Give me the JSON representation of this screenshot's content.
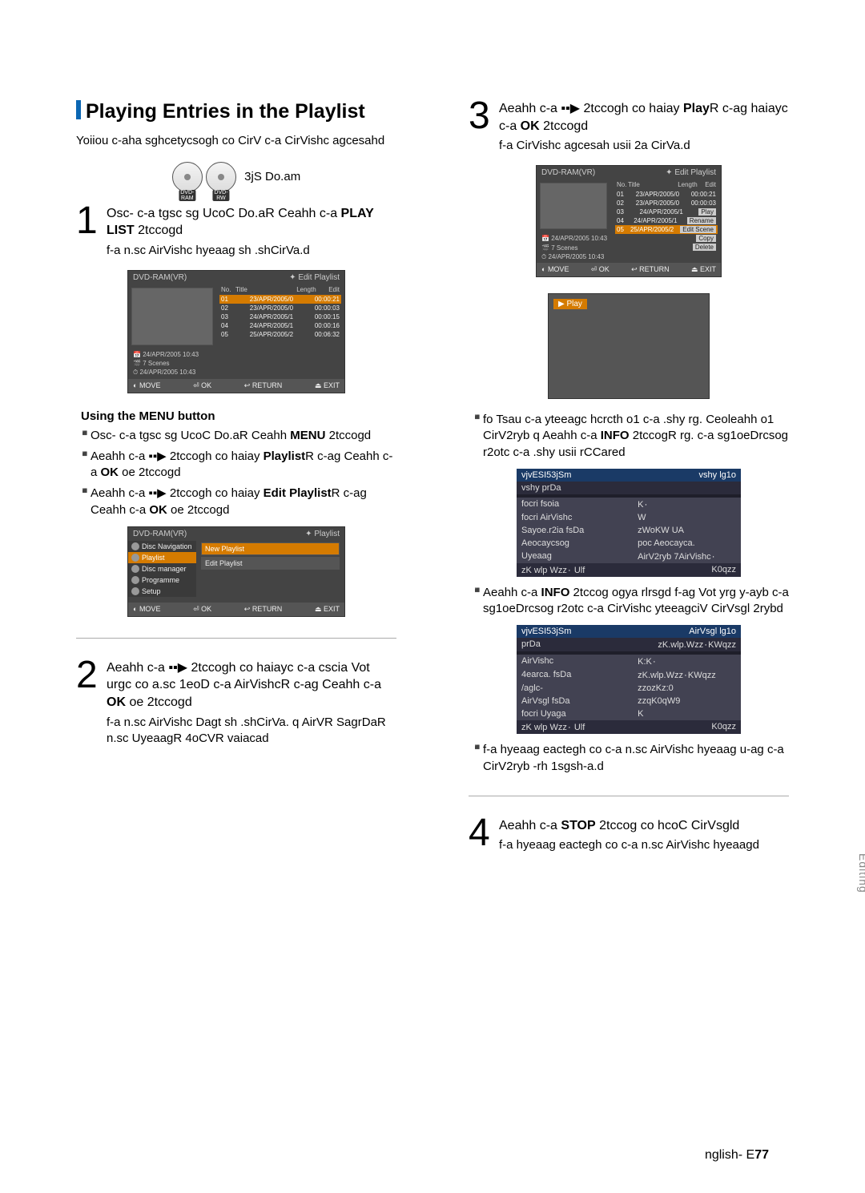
{
  "sectionTitle": "Playing Entries in the Playlist",
  "sectionDesc": "Yoiiou c-aha sghcetycsogh co CirV c-a CirVishc agcesahd",
  "mediaNote": "3jS Do.am",
  "mediaLabels": {
    "ram": "DVD-RAM",
    "rw": "DVD-RW"
  },
  "step1": {
    "text_a": "Osc- c-a tgsc sg UcoC Do.aR Ceahh c-a ",
    "text_b": "PLAY LIST",
    "text_c": " 2tccogd",
    "sub": "f-a n.sc AirVishc hyeaag sh .shCirVa.d"
  },
  "osd1": {
    "topLeft": "DVD-RAM(VR)",
    "topRight": "✦ Edit Playlist",
    "header": {
      "no": "No.",
      "title": "Title",
      "length": "Length",
      "edit": "Edit"
    },
    "rows": [
      {
        "n": "01",
        "t": "23/APR/2005/0",
        "l": "00:00:21",
        "sel": true
      },
      {
        "n": "02",
        "t": "23/APR/2005/0",
        "l": "00:00:03"
      },
      {
        "n": "03",
        "t": "24/APR/2005/1",
        "l": "00:00:15"
      },
      {
        "n": "04",
        "t": "24/APR/2005/1",
        "l": "00:00:16"
      },
      {
        "n": "05",
        "t": "25/APR/2005/2",
        "l": "00:06:32"
      }
    ],
    "info": [
      "24/APR/2005 10:43",
      "7 Scenes",
      "24/APR/2005 10:43"
    ],
    "bottom": {
      "move": "MOVE",
      "ok": "OK",
      "ret": "RETURN",
      "exit": "EXIT"
    }
  },
  "menuHead": "Using the MENU button",
  "menuBullets": [
    {
      "a": "Osc- c-a tgsc sg UcoC Do.aR Ceahh ",
      "b": "MENU",
      "c": " 2tccogd"
    },
    {
      "a": "Aeahh c-a ▪▪▶ 2tccogh co haiay ",
      "b": "Playlist",
      "c": "R c-ag Ceahh c-a ",
      "d": "OK",
      "e": " oe   2tccogd"
    },
    {
      "a": "Aeahh c-a ▪▪▶ 2tccogh co haiay ",
      "b": "Edit Playlist",
      "c": "R c-ag Ceahh c-a ",
      "d": "OK",
      "e": " oe   2tccogd"
    }
  ],
  "osdMenu": {
    "topLeft": "DVD-RAM(VR)",
    "topRight": "✦ Playlist",
    "side": [
      "Disc Navigation",
      "Playlist",
      "Disc manager",
      "Programme",
      "Setup"
    ],
    "panel": [
      "New Playlist",
      "Edit Playlist"
    ],
    "bottom": {
      "move": "MOVE",
      "ok": "OK",
      "ret": "RETURN",
      "exit": "EXIT"
    }
  },
  "step2": {
    "text_a": "Aeahh c-a ▪▪▶ 2tccogh co haiayc c-a cscia Vot urgc co a.sc 1eoD c-a AirVishcR c-ag Ceahh c-a ",
    "text_b": "OK",
    "text_c": " oe   2tccogd",
    "sub": "f-a n.sc AirVishc Dagt sh .shCirVa. q AirVR SagrDaR n.sc UyeaagR 4oCVR vaiacad"
  },
  "step3": {
    "text_a": "Aeahh c-a ▪▪▶ 2tccogh co haiay ",
    "text_b": "Play",
    "text_c": "R c-ag haiayc c-a ",
    "text_d": "OK",
    "text_e": " 2tccogd",
    "sub": "f-a CirVishc agcesah usii 2a CirVa.d"
  },
  "osd3": {
    "topLeft": "DVD-RAM(VR)",
    "topRight": "✦ Edit Playlist",
    "header": {
      "no": "No.",
      "title": "Title",
      "length": "Length",
      "edit": "Edit"
    },
    "rows": [
      {
        "n": "01",
        "t": "23/APR/2005/0",
        "l": "00:00:21"
      },
      {
        "n": "02",
        "t": "23/APR/2005/0",
        "l": "00:00:03"
      },
      {
        "n": "03",
        "t": "24/APR/2005/1",
        "ctx": "Play"
      },
      {
        "n": "04",
        "t": "24/APR/2005/1",
        "ctx": "Rename"
      },
      {
        "n": "05",
        "t": "25/APR/2005/2",
        "ctx": "Edit Scene",
        "sel": true
      }
    ],
    "ctxExtra": [
      "Copy",
      "Delete"
    ],
    "info": [
      "24/APR/2005 10:43",
      "7 Scenes",
      "24/APR/2005 10:43"
    ],
    "bottom": {
      "move": "MOVE",
      "ok": "OK",
      "ret": "RETURN",
      "exit": "EXIT"
    }
  },
  "playBadge": "▶ Play",
  "rightBullets": [
    {
      "a": "fo Tsau c-a yteeagc hcrcth o1 c-a .shy rg. Ceoleahh o1 CirV2ryb q Aeahh c-a ",
      "b": "INFO",
      "c": " 2tccogR rg. c-a sg1oeDrcsog r2otc c-a .shy usii rCCared"
    },
    {
      "a": "Aeahh c-a ",
      "b": "INFO",
      "c": " 2tccog ogya rlrsgd f-ag Vot yrg y-ayb c-a sg1oeDrcsog r2otc c-a CirVishc yteeagciV CirVsgl 2rybd"
    },
    {
      "a": "f-a hyeaag eactegh co c-a n.sc AirVishc hyeaag u-ag c-a CirV2ryb -rh 1sgsh-a.d"
    }
  ],
  "table1": {
    "hdrL": "vjvESI53jSm",
    "hdrR": "vshy lg1o",
    "rows": [
      {
        "l": "vshy prDa",
        "r": ""
      },
      {
        "l": "focri fsoia",
        "r": "K٠"
      },
      {
        "l": "focri AirVishc",
        "r": "W"
      },
      {
        "l": "Sayoe.r2ia fsDa",
        "r": "zWoKW  UA"
      },
      {
        "l": "Aeocaycsog",
        "r": "poc Aeocayca."
      },
      {
        "l": "Uyeaag",
        "r": "AirV2ryb 7AirVishc٠"
      },
      {
        "l": "zK wlp Wzz٠ Ulf",
        "r": "K0qzz"
      }
    ]
  },
  "table2": {
    "hdrL": "vjvESI53jSm",
    "hdrR": "AirVsgl lg1o",
    "rows": [
      {
        "l": "prDa",
        "r": "zK.wlp.Wzz٠KWqzz"
      },
      {
        "l": "AirVishc",
        "r": "K:K٠"
      },
      {
        "l": "4earca. fsDa",
        "r": "zK.wlp.Wzz٠KWqzz"
      },
      {
        "l": "/aglc-",
        "r": "zzozKz:0"
      },
      {
        "l": "AirVsgl fsDa",
        "r": "zzqK0qW9"
      },
      {
        "l": "focri Uyaga",
        "r": "K"
      },
      {
        "l": "zK wlp Wzz٠ Ulf",
        "r": "K0qzz"
      }
    ]
  },
  "step4": {
    "text_a": "Aeahh c-a ",
    "text_b": "STOP",
    "text_c": " 2tccog co hcoC CirVsgld",
    "sub": "f-a hyeaag eactegh co c-a n.sc AirVishc hyeaagd"
  },
  "sideTab": "Editing",
  "pageNum": {
    "a": "nglish- E",
    "b": "77"
  }
}
